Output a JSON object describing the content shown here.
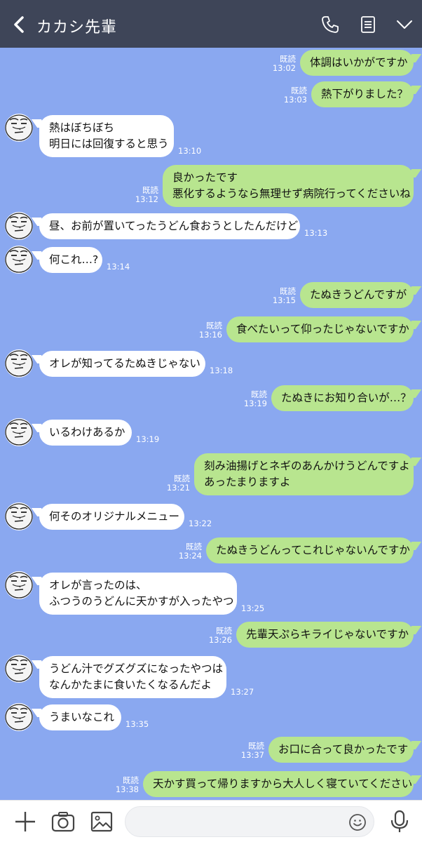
{
  "header": {
    "title": "カカシ先輩",
    "icons": [
      "back-icon",
      "phone-icon",
      "notes-icon",
      "chevron-down-icon"
    ]
  },
  "messages": [
    {
      "side": "out",
      "text": "体調はいかがですか",
      "read": "既読",
      "time": "13:02"
    },
    {
      "side": "out",
      "text": "熱下がりました？",
      "read": "既読",
      "time": "13:03"
    },
    {
      "side": "in",
      "text": "熱はぼちぼち\n明日には回復すると思う",
      "time": "13:10"
    },
    {
      "side": "out",
      "text": "良かったです\n悪化するようなら無理せず病院行ってくださいね",
      "read": "既読",
      "time": "13:12"
    },
    {
      "side": "in",
      "text": "昼、お前が置いてったうどん食おうとしたんだけど",
      "time": "13:13"
    },
    {
      "side": "in",
      "text": "何これ…?",
      "time": "13:14"
    },
    {
      "side": "out",
      "text": "たぬきうどんですが",
      "read": "既読",
      "time": "13:15"
    },
    {
      "side": "out",
      "text": "食べたいって仰ったじゃないですか",
      "read": "既読",
      "time": "13:16"
    },
    {
      "side": "in",
      "text": "オレが知ってるたぬきじゃない",
      "time": "13:18"
    },
    {
      "side": "out",
      "text": "たぬきにお知り合いが…？",
      "read": "既読",
      "time": "13:19"
    },
    {
      "side": "in",
      "text": "いるわけあるか",
      "time": "13:19"
    },
    {
      "side": "out",
      "text": "刻み油揚げとネギのあんかけうどんですよ\nあったまりますよ",
      "read": "既読",
      "time": "13:21"
    },
    {
      "side": "in",
      "text": "何そのオリジナルメニュー",
      "time": "13:22"
    },
    {
      "side": "out",
      "text": "たぬきうどんってこれじゃないんですか",
      "read": "既読",
      "time": "13:24"
    },
    {
      "side": "in",
      "text": "オレが言ったのは、\nふつうのうどんに天かすが入ったやつ",
      "time": "13:25"
    },
    {
      "side": "out",
      "text": "先輩天ぷらキライじゃないですか",
      "read": "既読",
      "time": "13:26"
    },
    {
      "side": "in",
      "text": "うどん汁でグズグズになったやつは\nなんかたまに食いたくなるんだよ",
      "time": "13:27"
    },
    {
      "side": "in",
      "text": "うまいなこれ",
      "time": "13:35"
    },
    {
      "side": "out",
      "text": "お口に合って良かったです",
      "read": "既読",
      "time": "13:37"
    },
    {
      "side": "out",
      "text": "天かす買って帰りますから大人しく寝ていてください",
      "read": "既読",
      "time": "13:38"
    }
  ],
  "footer": {
    "icons": [
      "plus-icon",
      "camera-icon",
      "image-icon",
      "emoji-icon",
      "microphone-icon"
    ],
    "input_value": ""
  },
  "colors": {
    "chat_bg": "#8aa8f0",
    "header_bg": "#3e4558",
    "outgoing_bubble": "#b8e58f",
    "incoming_bubble": "#ffffff"
  }
}
